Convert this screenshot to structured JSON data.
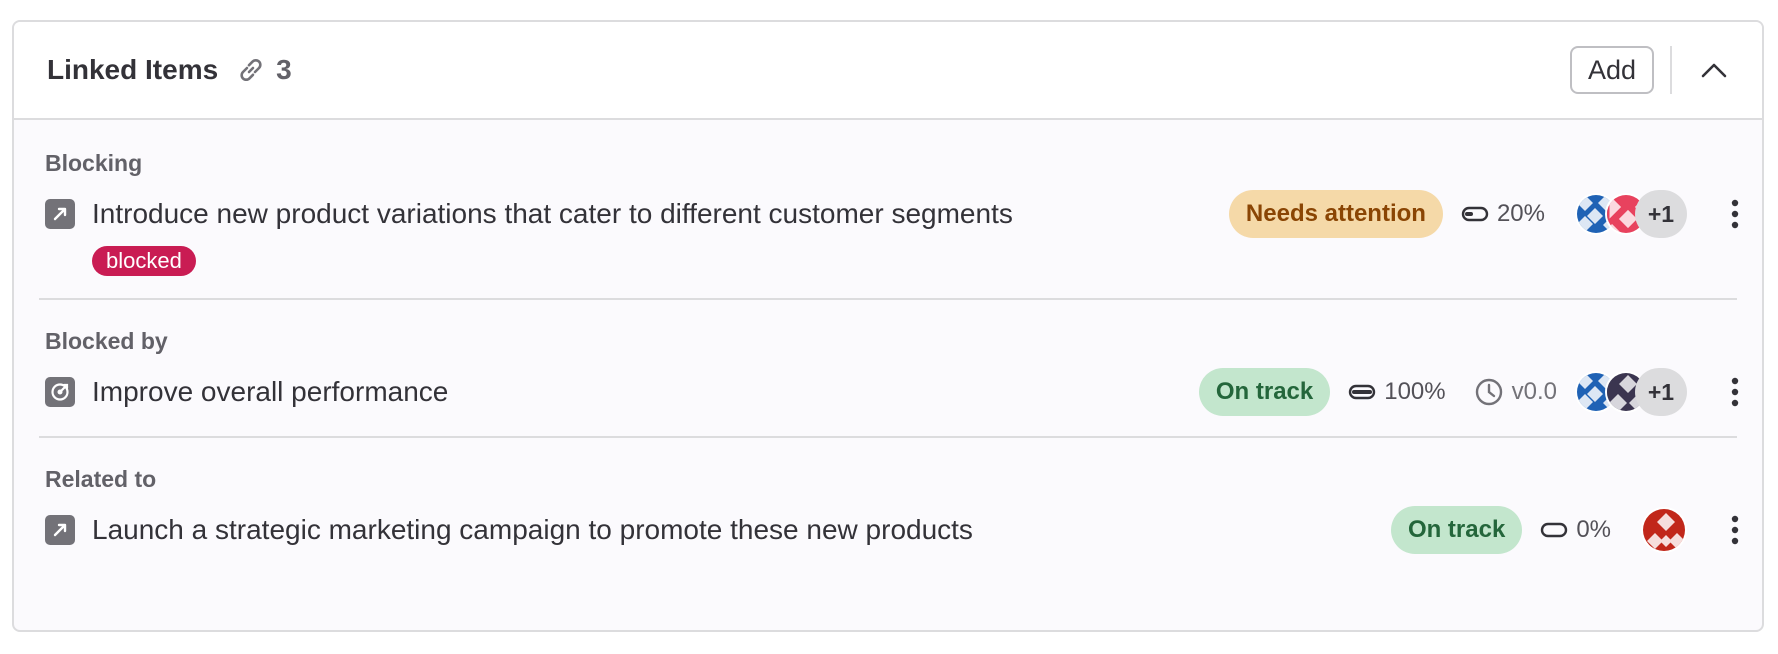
{
  "header": {
    "title": "Linked Items",
    "count": "3",
    "add_label": "Add"
  },
  "sections": [
    {
      "label": "Blocking",
      "item": {
        "title": "Introduce new product variations that cater to different customer segments",
        "label_badge": "blocked",
        "status": "Needs attention",
        "progress": "20%",
        "more_assignees": "+1"
      }
    },
    {
      "label": "Blocked by",
      "item": {
        "title": "Improve overall performance",
        "status": "On track",
        "progress": "100%",
        "milestone": "v0.0",
        "more_assignees": "+1"
      }
    },
    {
      "label": "Related to",
      "item": {
        "title": "Launch a strategic marketing campaign to promote these new products",
        "status": "On track",
        "progress": "0%"
      }
    }
  ],
  "colors": {
    "needs_attention_bg": "#f5d9a8",
    "on_track_bg": "#c3e6cd",
    "blocked_label": "#c91c53"
  },
  "icons": [
    "link-icon",
    "chevron-up-icon",
    "epic-icon",
    "objective-icon",
    "progress-icon",
    "clock-icon",
    "kebab-icon"
  ]
}
